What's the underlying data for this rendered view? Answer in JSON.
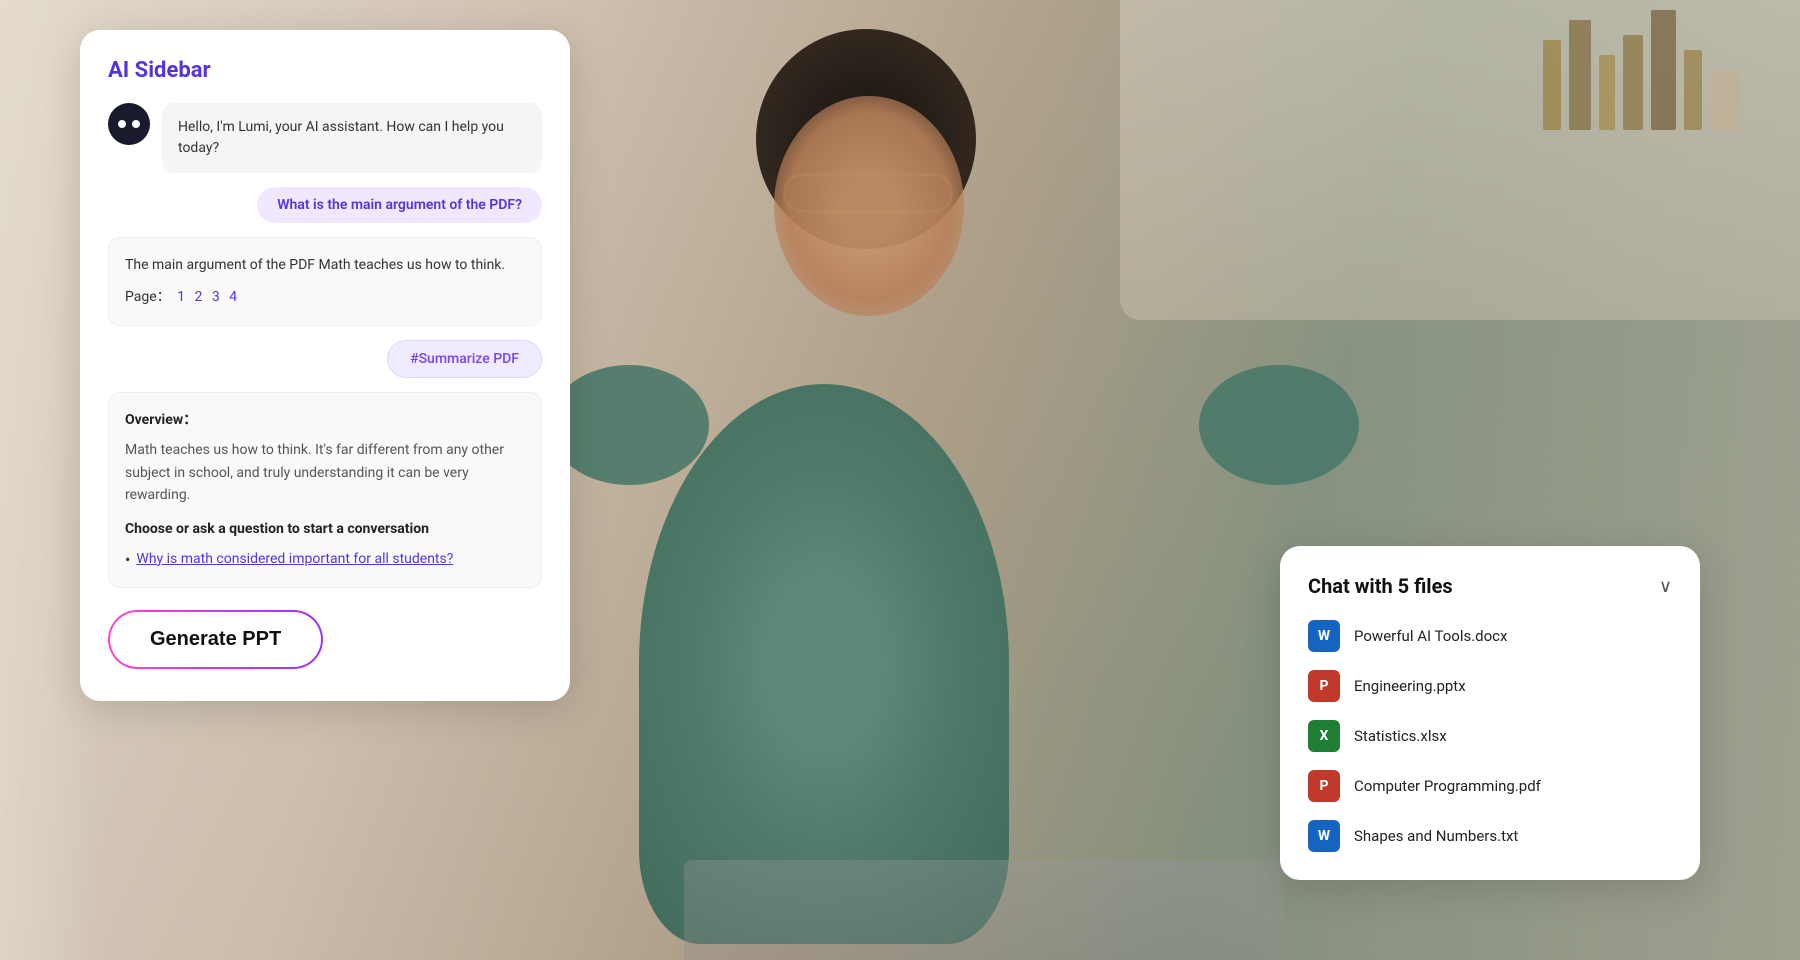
{
  "background": {
    "gradient_start": "#d8d0c8",
    "gradient_end": "#b8a898"
  },
  "ai_sidebar": {
    "title": "AI Sidebar",
    "avatar_label": "AI avatar",
    "greeting": "Hello, I'm Lumi, your AI assistant. How can I help you today?",
    "user_question": "What is the main argument of the PDF?",
    "ai_answer": "The main argument of the PDF Math teaches us how to think.",
    "page_label": "Page：",
    "page_refs": [
      "1",
      "2",
      "3",
      "4"
    ],
    "summarize_tag": "#Summarize PDF",
    "overview_title": "Overview：",
    "overview_text": "Math teaches us how to think. It's far different from any other subject in school, and truly understanding it can be very rewarding.",
    "choose_label": "Choose or ask a question to start a conversation",
    "question_link": "Why is math considered important for all students?",
    "generate_btn": "Generate PPT"
  },
  "chat_files": {
    "title": "Chat with 5 files",
    "chevron": "∨",
    "files": [
      {
        "name": "Powerful AI Tools.docx",
        "type": "word",
        "icon_letter": "W"
      },
      {
        "name": "Engineering.pptx",
        "type": "ppt",
        "icon_letter": "P"
      },
      {
        "name": "Statistics.xlsx",
        "type": "excel",
        "icon_letter": "X"
      },
      {
        "name": "Computer Programming.pdf",
        "type": "pdf",
        "icon_letter": "P"
      },
      {
        "name": "Shapes and Numbers.txt",
        "type": "txt",
        "icon_letter": "W"
      }
    ]
  }
}
